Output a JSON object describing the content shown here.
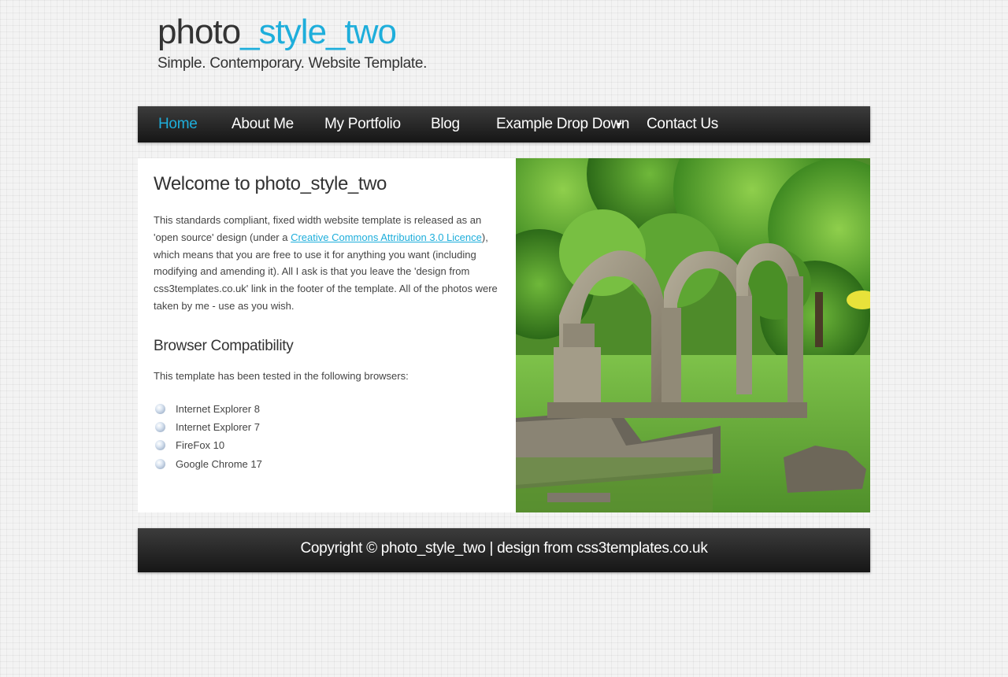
{
  "header": {
    "logo_main": "photo",
    "logo_accent": "_style_two",
    "slogan": "Simple. Contemporary. Website Template."
  },
  "nav": {
    "items": [
      {
        "label": "Home",
        "active": true
      },
      {
        "label": "About Me"
      },
      {
        "label": "My Portfolio"
      },
      {
        "label": "Blog"
      },
      {
        "label": "Example Drop Down",
        "has_dropdown": true
      },
      {
        "label": "Contact Us"
      }
    ]
  },
  "content": {
    "title": "Welcome to photo_style_two",
    "intro_before_link": "This standards compliant, fixed width website template is released as an 'open source' design (under a ",
    "intro_link": "Creative Commons Attribution 3.0 Licence",
    "intro_after_link": "), which means that you are free to use it for anything you want (including modifying and amending it). All I ask is that you leave the 'design from css3templates.co.uk' link in the footer of the template. All of the photos were taken by me - use as you wish.",
    "compat_title": "Browser Compatibility",
    "compat_text": "This template has been tested in the following browsers:",
    "browsers": [
      "Internet Explorer 8",
      "Internet Explorer 7",
      "FireFox 10",
      "Google Chrome 17"
    ]
  },
  "footer": {
    "copyright": "Copyright © photo_style_two | design from css3templates.co.uk"
  },
  "colors": {
    "accent": "#1eaedb",
    "text": "#333333",
    "nav_bg": "#262626"
  }
}
